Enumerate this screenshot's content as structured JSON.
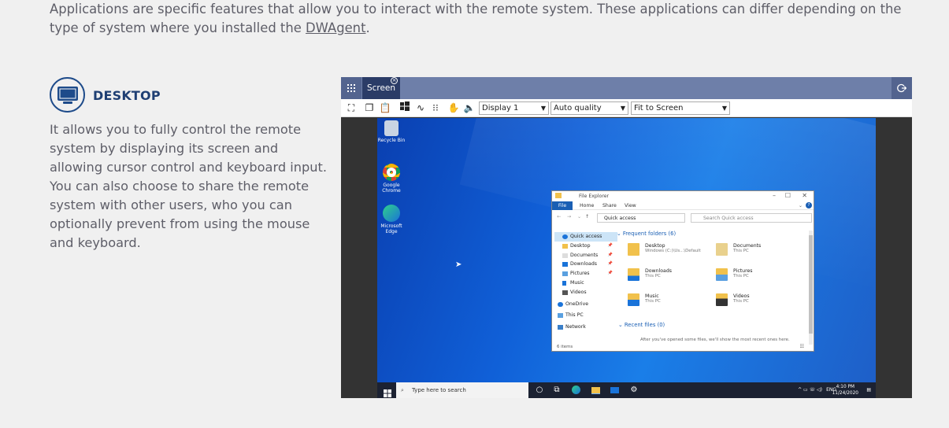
{
  "intro": {
    "text_before": "Applications are specific features that allow you to interact with the remote system. These applications can differ depending on the type of system where you installed the ",
    "link": "DWAgent",
    "text_after": "."
  },
  "feature": {
    "icon": "monitor-icon",
    "title": "DESKTOP",
    "description": "It allows you to fully control the remote system by displaying its screen and allowing cursor control and keyboard input. You can also choose to share the remote system with other users, who you can optionally prevent from using the mouse and keyboard."
  },
  "app": {
    "tab_label": "Screen",
    "toolbar": {
      "display_select": "Display 1",
      "quality_select": "Auto quality",
      "fit_select": "Fit to Screen"
    },
    "desktop": {
      "icons": [
        {
          "label": "Recycle Bin"
        },
        {
          "label": "Google Chrome"
        },
        {
          "label": "Microsoft Edge"
        }
      ]
    },
    "explorer": {
      "title": "File Explorer",
      "ribbon": {
        "file": "File",
        "home": "Home",
        "share": "Share",
        "view": "View"
      },
      "address": "Quick access",
      "search_placeholder": "Search Quick access",
      "nav": [
        "Quick access",
        "Desktop",
        "Documents",
        "Downloads",
        "Pictures",
        "Music",
        "Videos",
        "OneDrive",
        "This PC",
        "Network"
      ],
      "frequent_header": "Frequent folders (6)",
      "folders": [
        {
          "name": "Desktop",
          "sub": "Windows (C:)\\Us...\\Default"
        },
        {
          "name": "Documents",
          "sub": "This PC"
        },
        {
          "name": "Downloads",
          "sub": "This PC"
        },
        {
          "name": "Pictures",
          "sub": "This PC"
        },
        {
          "name": "Music",
          "sub": "This PC"
        },
        {
          "name": "Videos",
          "sub": "This PC"
        }
      ],
      "recent_header": "Recent files (0)",
      "recent_empty": "After you've opened some files, we'll show the most recent ones here.",
      "status": "6 items"
    },
    "taskbar": {
      "search_placeholder": "Type here to search",
      "tray_lang": "ENG",
      "time": "4:10 PM",
      "date": "11/24/2020"
    }
  },
  "colors": {
    "title": "#1f3f73",
    "topbar": "#6e7fa9",
    "tab": "#2b3c67"
  }
}
